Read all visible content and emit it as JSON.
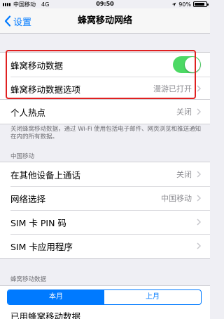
{
  "status_bar": {
    "carrier": "中国移动",
    "network": "4G",
    "time": "09:50",
    "battery_text": "90%",
    "battery_level": 0.9
  },
  "nav": {
    "back_label": "设置",
    "title": "蜂窝移动网络"
  },
  "cellular_group": {
    "data_label": "蜂窝移动数据",
    "data_enabled": true,
    "options_label": "蜂窝移动数据选项",
    "options_value": "漫游已打开"
  },
  "hotspot": {
    "label": "个人热点",
    "value": "关闭"
  },
  "footnote": "关闭蜂窝移动数据，通过 Wi-Fi 使用包括电子邮件、网页浏览和推送通知在内的所有数据。",
  "carrier_section": {
    "header": "中国移动",
    "items": [
      {
        "label": "在其他设备上通话",
        "value": "关闭"
      },
      {
        "label": "网络选择",
        "value": "中国移动"
      },
      {
        "label": "SIM 卡 PIN 码",
        "value": ""
      },
      {
        "label": "SIM 卡应用程序",
        "value": ""
      }
    ]
  },
  "usage_section": {
    "header": "蜂窝移动数据",
    "segments": [
      "本月",
      "上月"
    ],
    "selected": "本月",
    "partial_row_label": "已用蜂窝移动数据"
  },
  "colors": {
    "accent": "#007aff",
    "toggle_on": "#4cd964",
    "highlight": "#e02020"
  }
}
